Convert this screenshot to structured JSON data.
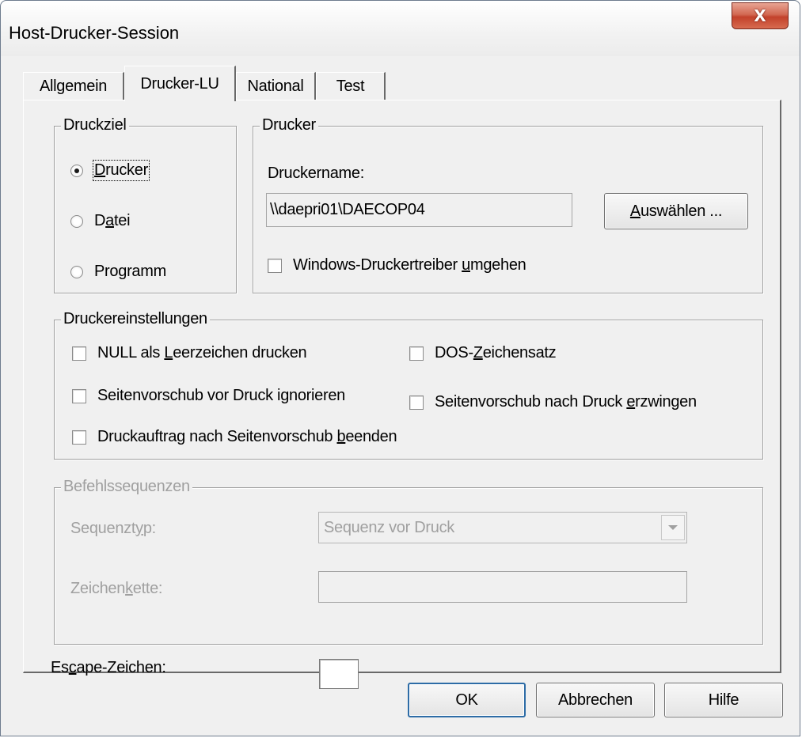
{
  "window": {
    "title": "Host-Drucker-Session",
    "close_label": "X"
  },
  "tabs": [
    {
      "label": "Allgemein"
    },
    {
      "label": "Drucker-LU"
    },
    {
      "label": "National"
    },
    {
      "label": "Test"
    }
  ],
  "active_tab": "Drucker-LU",
  "druckziel": {
    "label": "Druckziel",
    "options": [
      {
        "pre": "",
        "ul": "D",
        "post": "rucker",
        "checked": true
      },
      {
        "pre": "D",
        "ul": "a",
        "post": "tei",
        "checked": false
      },
      {
        "pre": "Pro",
        "ul": "g",
        "post": "ramm",
        "checked": false
      }
    ]
  },
  "drucker": {
    "label": "Drucker",
    "name_label": "Druckername:",
    "name_value": "\\\\daepri01\\DAECOP04",
    "select_button": {
      "ul": "A",
      "post": "uswählen ..."
    },
    "bypass_driver": {
      "pre": "Windows-Druckertreiber ",
      "ul": "u",
      "post": "mgehen",
      "checked": false
    }
  },
  "einstellungen": {
    "label": "Druckereinstellungen",
    "null_as_space": {
      "pre": "NULL als ",
      "ul": "L",
      "post": "eerzeichen drucken",
      "checked": false
    },
    "dos_charset": {
      "pre": "DOS-",
      "ul": "Z",
      "post": "eichensatz",
      "checked": false
    },
    "ff_before_ignore": {
      "pre": "Seitenvorschub vor Druck i",
      "ul": "g",
      "post": "norieren",
      "checked": false
    },
    "ff_after_force": {
      "pre": "Seitenvorschub nach Druck ",
      "ul": "e",
      "post": "rzwingen",
      "checked": false
    },
    "end_job_after_ff": {
      "pre": "Druckauftrag nach Seitenvorschub ",
      "ul": "b",
      "post": "eenden",
      "checked": false
    }
  },
  "sequenzen": {
    "label": "Befehlssequenzen",
    "type_label": {
      "pre": "Sequenzt",
      "ul": "y",
      "post": "p:"
    },
    "type_value": "Sequenz vor Druck",
    "string_label": {
      "pre": "Zeichen",
      "ul": "k",
      "post": "ette:"
    },
    "string_value": ""
  },
  "escape": {
    "pre": "Es",
    "ul": "c",
    "post": "ape-Zeichen:",
    "value": ""
  },
  "buttons": {
    "ok": "OK",
    "cancel": "Abbrechen",
    "help": "Hilfe"
  }
}
